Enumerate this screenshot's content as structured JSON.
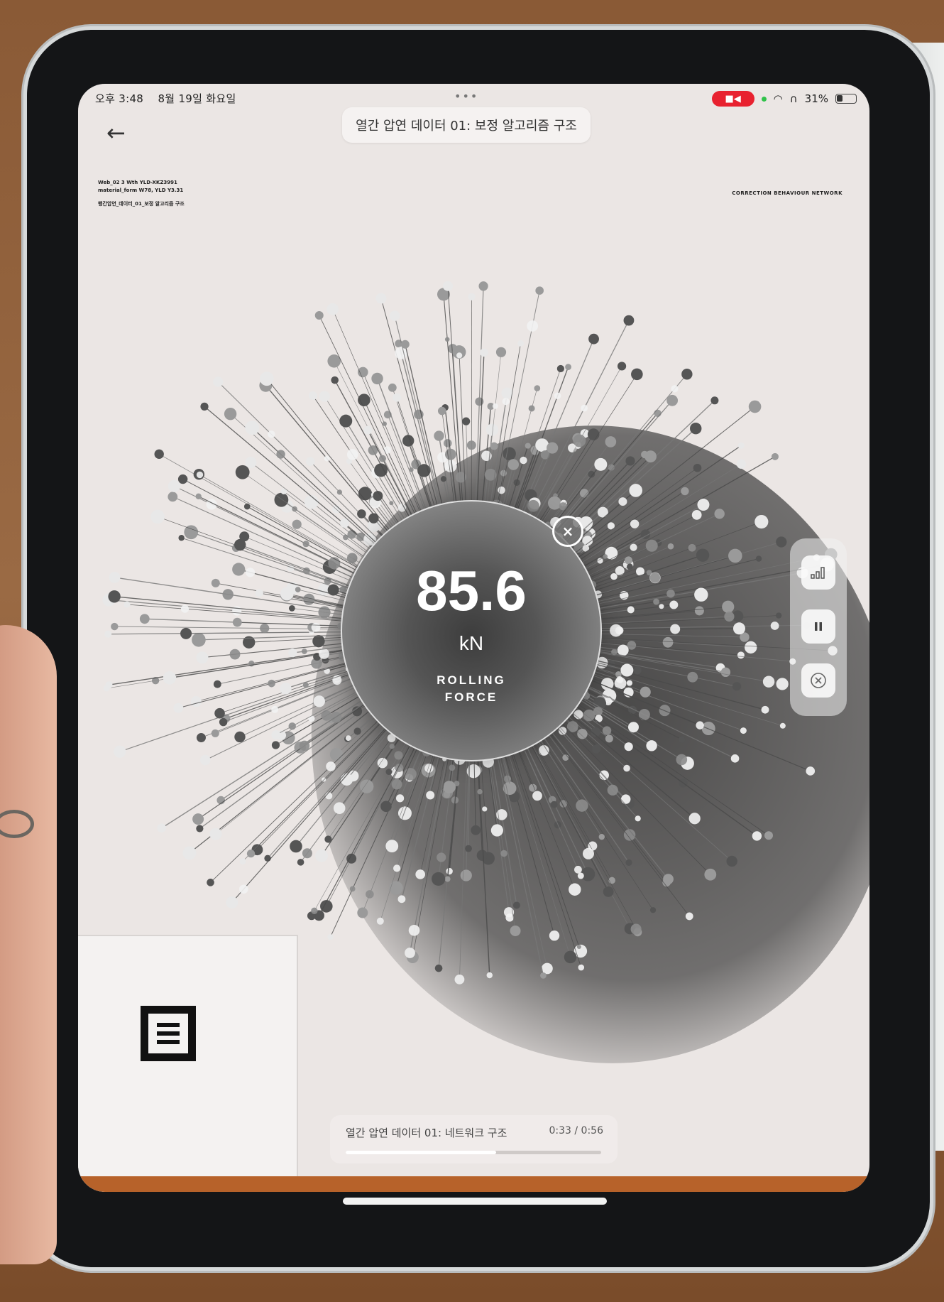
{
  "status_bar": {
    "time": "오후 3:48",
    "date": "8월 19일 화요일",
    "battery": "31%",
    "battery_level": 0.31,
    "record_icon": "video-record-icon",
    "wifi_icon": "wifi-icon",
    "headphones_icon": "headphones-icon"
  },
  "header": {
    "title": "열간 압연 데이터 01: 보정 알고리즘 구조",
    "back_icon": "arrow-left-icon"
  },
  "document": {
    "top_left_lines": [
      "Web_02 3 Wth YLD-XKZ3991",
      "material_form W78, YLD Y3.31",
      "행간압연_데이터_01_보정 알고리즘 구조"
    ],
    "top_right": "CORRECTION BEHAVIOUR NETWORK"
  },
  "dial": {
    "value": "85.6",
    "unit": "kN",
    "label_line1": "ROLLING",
    "label_line2": "FORCE",
    "close_symbol": "×"
  },
  "side_controls": {
    "chart_icon": "bar-chart-icon",
    "pause_icon": "pause-icon",
    "close_icon": "close-circle-icon"
  },
  "player": {
    "title": "열간 압연 데이터 01: 네트워크 구조",
    "time": "0:33 / 0:56",
    "progress": 0.59
  },
  "colors": {
    "record": "#e8212f",
    "screen_bg": "#ebe6e4",
    "dial_dark": "#3d3d3d"
  }
}
